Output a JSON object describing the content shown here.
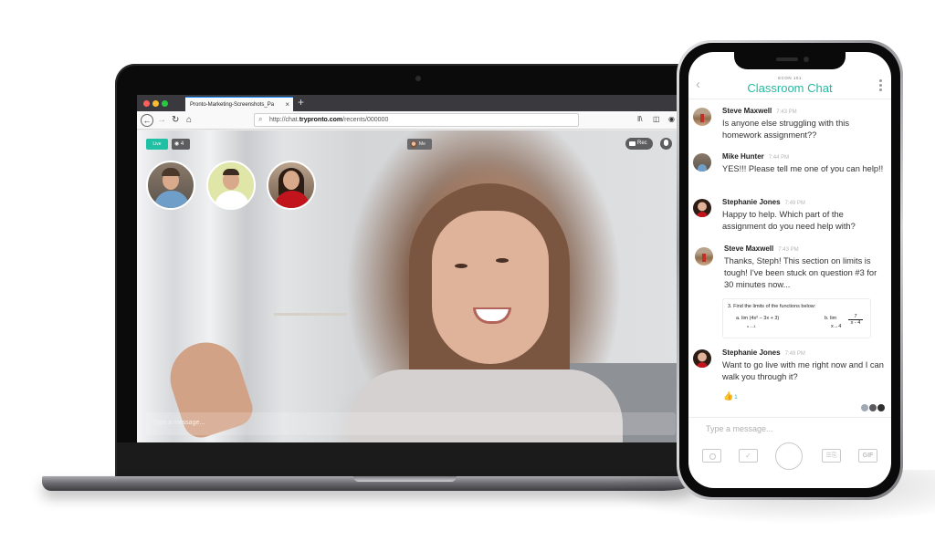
{
  "browser": {
    "window_controls": [
      "close",
      "minimize",
      "maximize"
    ],
    "tab_title": "Pronto-Marketing-Screenshots_Pa",
    "tab_close_icon": "×",
    "new_tab_icon": "+",
    "nav": {
      "back_icon": "←",
      "forward_icon": "→",
      "reload_icon": "↻",
      "home_icon": "⌂"
    },
    "url": {
      "prefix": "http://chat.",
      "host": "trypronto.com",
      "path": "/recents/000000",
      "search_icon": "⌕"
    },
    "toolbar_icons": [
      "library-icon",
      "sidebar-icon",
      "account-icon"
    ],
    "toolbar_glyphs": [
      "ǁ\\",
      "◫",
      "◉"
    ]
  },
  "video_call": {
    "live_label": "Live",
    "viewer_count": "4",
    "viewer_icon": "👁",
    "me_label": "Me",
    "rec_label": "Rec",
    "participants": [
      "participant-1",
      "participant-2",
      "participant-3"
    ],
    "message_placeholder": "Type a message..."
  },
  "phone": {
    "course": "ECON 101",
    "title": "Classroom Chat",
    "back_icon": "‹",
    "messages": [
      {
        "name": "Steve Maxwell",
        "time": "7:43 PM",
        "text": "Is anyone else struggling with this homework assignment??"
      },
      {
        "name": "Mike Hunter",
        "time": "7:44 PM",
        "text": "YES!!! Please tell me one of you can help!!"
      },
      {
        "name": "Stephanie Jones",
        "time": "7:49 PM",
        "text": "Happy to help. Which part of the assignment do you need help with?"
      },
      {
        "name": "Steve Maxwell",
        "time": "7:43 PM",
        "text": "Thanks, Steph! This section on limits is tough! I've been stuck on question #3 for 30 minutes now..."
      },
      {
        "name": "Stephanie Jones",
        "time": "7:49 PM",
        "text": "Want to go live with me right now and I can walk you through it?"
      }
    ],
    "attachment": {
      "question": "3.  Find the limits of the functions below:",
      "part_a": "a.   lim (4x² – 3x + 3)",
      "part_a_sub": "x→-1",
      "part_b": "b.  lim",
      "part_b_numerator": "7",
      "part_b_denominator": "x - 4",
      "part_b_sub": "x→4"
    },
    "reaction": {
      "emoji": "👍",
      "count": "1"
    },
    "input_placeholder": "Type a message...",
    "tools": {
      "check": "✓",
      "doc": "☰⎘",
      "gif": "GIF"
    }
  }
}
